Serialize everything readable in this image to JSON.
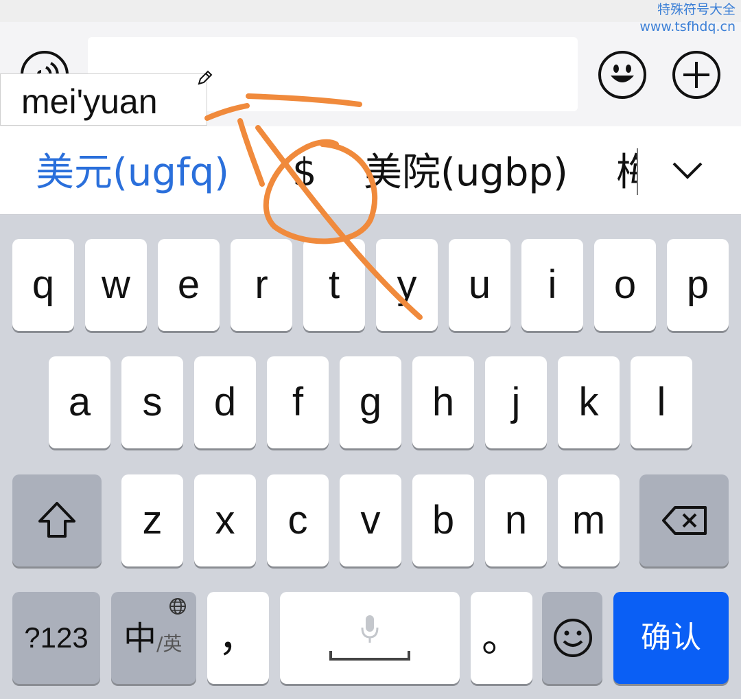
{
  "watermark": {
    "line1": "特殊符号大全",
    "line2": "www.tsfhdq.cn"
  },
  "composition": {
    "text": "mei'yuan"
  },
  "candidates": {
    "items": [
      "美元(ugfq)",
      "$",
      "美院(ugbp)",
      "梅"
    ]
  },
  "keyboard": {
    "row1": [
      "q",
      "w",
      "e",
      "r",
      "t",
      "y",
      "u",
      "i",
      "o",
      "p"
    ],
    "row2": [
      "a",
      "s",
      "d",
      "f",
      "g",
      "h",
      "j",
      "k",
      "l"
    ],
    "row3": [
      "z",
      "x",
      "c",
      "v",
      "b",
      "n",
      "m"
    ],
    "numbers_label": "?123",
    "lang_main": "中",
    "lang_sub": "/英",
    "comma_label": "，",
    "period_label": "。",
    "confirm_label": "确认"
  },
  "colors": {
    "accent_blue": "#0a5ff5",
    "candidate_blue": "#2a6fdb",
    "annotation_orange": "#f08a3c"
  }
}
